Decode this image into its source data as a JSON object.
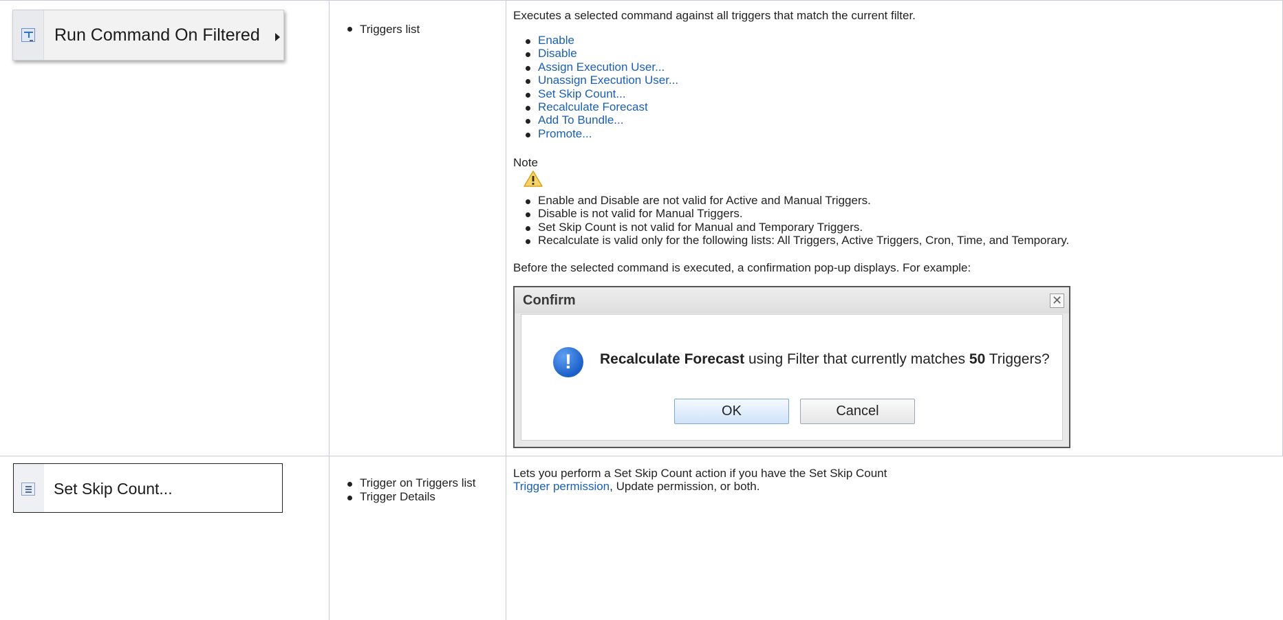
{
  "row1": {
    "menu_label": "Run Command On Filtered",
    "location_items": [
      "Triggers list"
    ],
    "intro": "Executes a selected command against all triggers that match the current filter.",
    "commands": [
      "Enable",
      "Disable",
      "Assign Execution User...",
      "Unassign Execution User...",
      "Set Skip Count...",
      "Recalculate Forecast",
      "Add To Bundle...",
      "Promote..."
    ],
    "note_label": "Note",
    "note_items": [
      "Enable and Disable are not valid for Active and Manual Triggers.",
      "Disable is not valid for Manual Triggers.",
      "Set Skip Count is not valid for Manual and Temporary Triggers.",
      "Recalculate is valid only for the following lists: All Triggers, Active Triggers, Cron, Time, and Temporary."
    ],
    "before_text": "Before the selected command is executed, a confirmation pop-up displays. For example:",
    "dialog": {
      "title": "Confirm",
      "close_glyph": "✕",
      "msg_bold": "Recalculate Forecast",
      "msg_mid": " using Filter that currently matches ",
      "msg_count": "50",
      "msg_end": " Triggers?",
      "ok_label": "OK",
      "cancel_label": "Cancel"
    }
  },
  "row2": {
    "menu_label": "Set Skip Count...",
    "location_items": [
      "Trigger on Triggers list",
      "Trigger Details"
    ],
    "desc_before": "Lets you perform a Set Skip Count action if you have the Set Skip Count ",
    "desc_link": "Trigger permission",
    "desc_after": ", Update permission, or both."
  },
  "icons": {
    "run_command": "run-command-icon",
    "submenu_arrow": "submenu-arrow-icon",
    "warning": "warning-icon",
    "info": "info-icon",
    "close": "close-icon",
    "skip_count": "skip-count-icon"
  },
  "colors": {
    "link": "#1a5fb4",
    "border": "#c7ccd6",
    "warning": "#f5c542"
  }
}
